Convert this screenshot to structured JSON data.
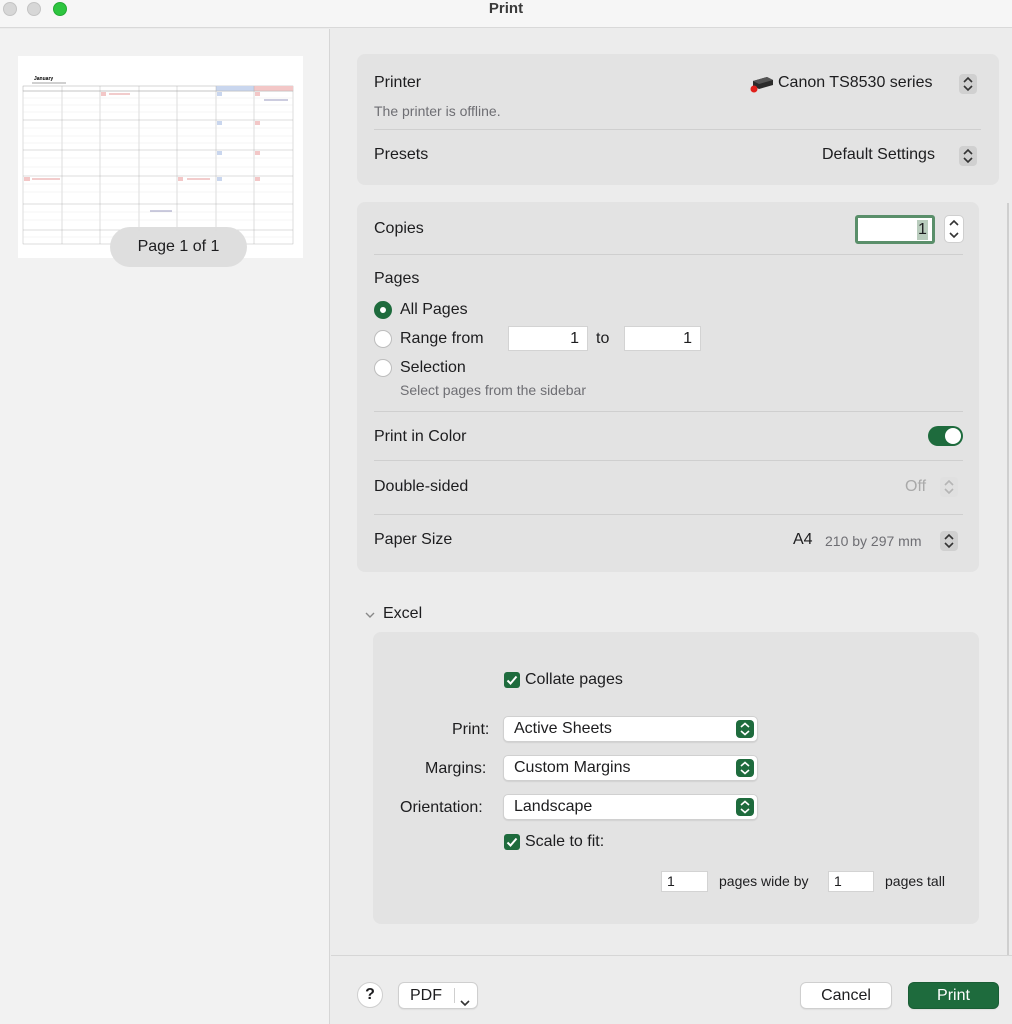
{
  "window": {
    "title": "Print"
  },
  "preview": {
    "page_indicator": "Page 1 of 1",
    "calendar_title": "January"
  },
  "printer": {
    "label": "Printer",
    "value": "Canon TS8530 series",
    "status": "The printer is offline.",
    "icon": "printer-icon"
  },
  "presets": {
    "label": "Presets",
    "value": "Default Settings"
  },
  "copies": {
    "label": "Copies",
    "value": "1"
  },
  "pages": {
    "label": "Pages",
    "all_label": "All Pages",
    "range_label": "Range from",
    "range_from": "1",
    "range_to_label": "to",
    "range_to": "1",
    "selection_label": "Selection",
    "selection_hint": "Select pages from the sidebar",
    "selected": "all"
  },
  "color": {
    "label": "Print in Color",
    "enabled": true
  },
  "double_sided": {
    "label": "Double-sided",
    "value": "Off"
  },
  "paper": {
    "label": "Paper Size",
    "size": "A4",
    "dimensions": "210 by 297 mm"
  },
  "excel": {
    "section_label": "Excel",
    "collate_label": "Collate pages",
    "collate_checked": true,
    "print_label": "Print:",
    "print_value": "Active Sheets",
    "margins_label": "Margins:",
    "margins_value": "Custom Margins",
    "orientation_label": "Orientation:",
    "orientation_value": "Landscape",
    "scale_label": "Scale to fit:",
    "scale_checked": true,
    "pages_wide": "1",
    "pages_wide_label": "pages wide by",
    "pages_tall": "1",
    "pages_tall_label": "pages tall"
  },
  "footer": {
    "help": "?",
    "pdf": "PDF",
    "cancel": "Cancel",
    "print": "Print"
  },
  "colors": {
    "accent": "#1e6b3d"
  }
}
